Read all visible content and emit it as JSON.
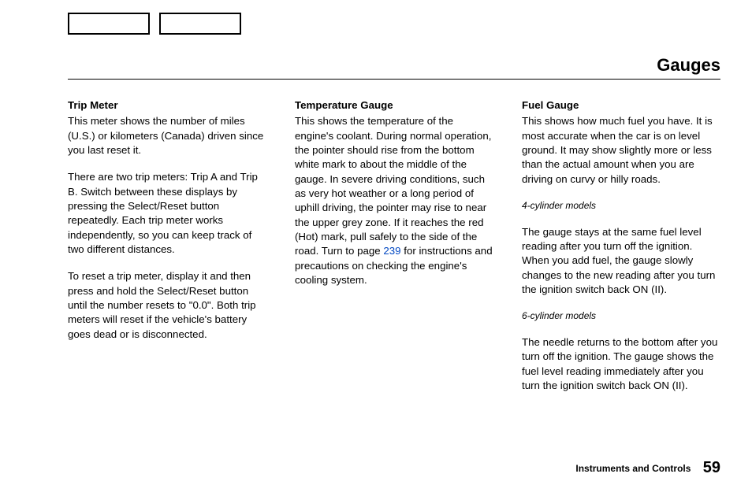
{
  "title": "Gauges",
  "footer": {
    "section": "Instruments and Controls",
    "page": "59"
  },
  "col1": {
    "heading": "Trip Meter",
    "p1": "This meter shows the number of miles (U.S.) or kilometers (Canada) driven since you last reset it.",
    "p2": "There are two trip meters: Trip A and Trip B. Switch between these displays by pressing the Select/Reset button repeatedly. Each trip meter works independently, so you can keep track of two different distances.",
    "p3": "To reset a trip meter, display it and then press and hold the Select/Reset button until the number resets to \"0.0\". Both trip meters will reset if the vehicle's battery goes dead or is disconnected."
  },
  "col2": {
    "heading": "Temperature Gauge",
    "p1a": "This shows the temperature of the engine's coolant. During normal operation, the pointer should rise from the bottom white mark to about the middle of the gauge. In severe driving conditions, such as very hot weather or a long period of uphill driving, the pointer may rise to near the upper grey zone. If it reaches the red (Hot) mark, pull safely to the side of the road. Turn to page ",
    "p1_link": "239",
    "p1b": " for instructions and precautions on checking the engine's cooling system."
  },
  "col3": {
    "heading": "Fuel Gauge",
    "p1": "This shows how much fuel you have. It is most accurate when the car is on level ground. It may show slightly more or less than the actual amount when you are driving on curvy or hilly roads.",
    "sub1": "4-cylinder models",
    "p2": "The gauge stays at the same fuel level reading after you turn off the ignition. When you add fuel, the gauge slowly changes to the new reading after you turn the ignition switch back ON (II).",
    "sub2": "6-cylinder models",
    "p3": "The needle returns to the bottom after you turn off the ignition. The gauge shows the fuel level reading immediately after you turn the ignition switch back ON (II)."
  }
}
